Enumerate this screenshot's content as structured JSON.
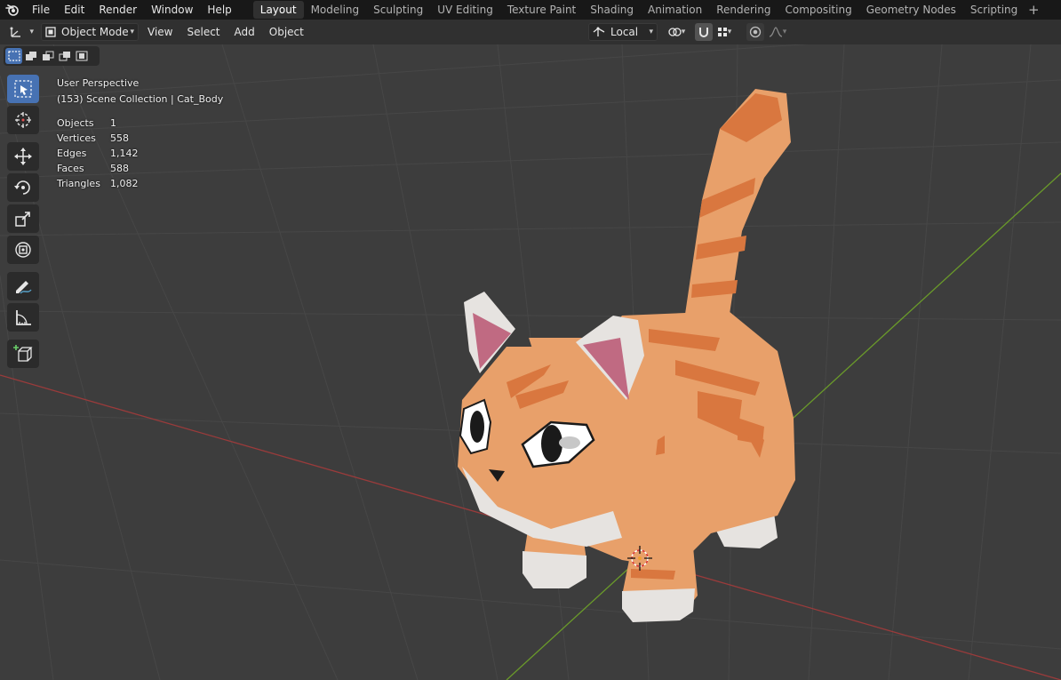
{
  "menu": {
    "items": [
      "File",
      "Edit",
      "Render",
      "Window",
      "Help"
    ]
  },
  "workspaces": {
    "tabs": [
      "Layout",
      "Modeling",
      "Sculpting",
      "UV Editing",
      "Texture Paint",
      "Shading",
      "Animation",
      "Rendering",
      "Compositing",
      "Geometry Nodes",
      "Scripting"
    ],
    "active": "Layout"
  },
  "header": {
    "mode": "Object Mode",
    "view": "View",
    "select": "Select",
    "add": "Add",
    "object": "Object",
    "orientation": "Local"
  },
  "overlay": {
    "view_name": "User Perspective",
    "collection": "(153) Scene Collection | Cat_Body",
    "stats": [
      {
        "label": "Objects",
        "value": "1"
      },
      {
        "label": "Vertices",
        "value": "558"
      },
      {
        "label": "Edges",
        "value": "1,142"
      },
      {
        "label": "Faces",
        "value": "588"
      },
      {
        "label": "Triangles",
        "value": "1,082"
      }
    ]
  },
  "icons": {
    "toolbar": [
      "select-box-icon",
      "cursor-icon",
      "move-icon",
      "rotate-icon",
      "scale-icon",
      "transform-icon",
      "annotate-icon",
      "measure-icon",
      "add-cube-icon"
    ]
  },
  "colors": {
    "accent": "#4772b3",
    "x_axis": "#9a3b3b",
    "y_axis": "#6a9a2a",
    "cat_orange": "#e8a06a",
    "cat_stripe": "#d9773f",
    "cat_white": "#e6e3e0",
    "ear_pink": "#c06a82"
  }
}
